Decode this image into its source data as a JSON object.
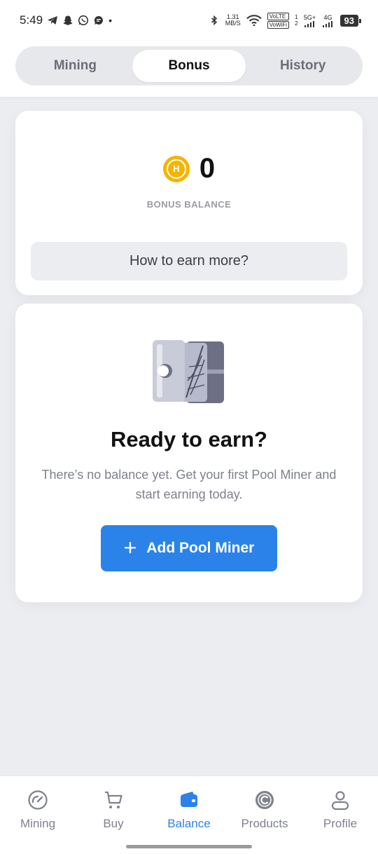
{
  "status_bar": {
    "time": "5:49",
    "speed_value": "1.31",
    "speed_unit": "MB/S",
    "volte": "VoLTE",
    "vowifi": "VoWiFi",
    "sim1": "1",
    "sim2": "2",
    "net1": "5G+",
    "net2": "4G",
    "battery": "93"
  },
  "tabs": [
    {
      "label": "Mining"
    },
    {
      "label": "Bonus"
    },
    {
      "label": "History"
    }
  ],
  "active_tab": "Bonus",
  "balance": {
    "value": "0",
    "label": "BONUS BALANCE",
    "coin_letter": "H",
    "earn_more_label": "How to earn more?"
  },
  "empty_state": {
    "title": "Ready to earn?",
    "description": "There’s no balance yet. Get your first Pool Miner and start earning today.",
    "button_label": "Add Pool Miner"
  },
  "bottom_nav": [
    {
      "label": "Mining",
      "icon": "speedometer-icon"
    },
    {
      "label": "Buy",
      "icon": "cart-icon"
    },
    {
      "label": "Balance",
      "icon": "wallet-icon"
    },
    {
      "label": "Products",
      "icon": "coin-c-icon"
    },
    {
      "label": "Profile",
      "icon": "user-icon"
    }
  ],
  "active_nav": "Balance",
  "colors": {
    "accent": "#2b83ea",
    "coin": "#f5b400",
    "background": "#ecedf1"
  }
}
